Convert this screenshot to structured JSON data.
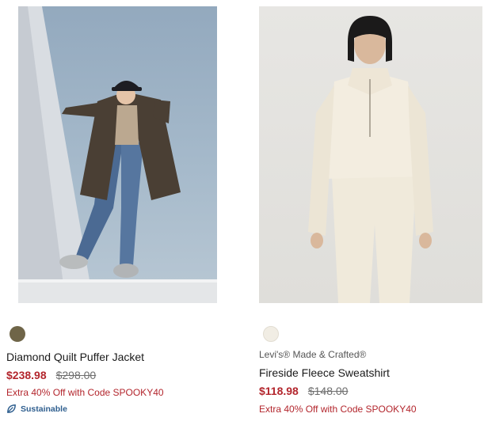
{
  "products": [
    {
      "brand": "",
      "name": "Diamond Quilt Puffer Jacket",
      "sale_price": "$238.98",
      "original_price": "$298.00",
      "promo": "Extra 40% Off with Code SPOOKY40",
      "badge": "Sustainable",
      "swatch_color": "#6f6548",
      "badge_icon": "leaf-icon"
    },
    {
      "brand": "Levi's® Made & Crafted®",
      "name": "Fireside Fleece Sweatshirt",
      "sale_price": "$118.98",
      "original_price": "$148.00",
      "promo": "Extra 40% Off with Code SPOOKY40",
      "swatch_color": "#f1ede4"
    }
  ],
  "colors": {
    "sale": "#b3262d",
    "badge": "#2f5f8f"
  }
}
